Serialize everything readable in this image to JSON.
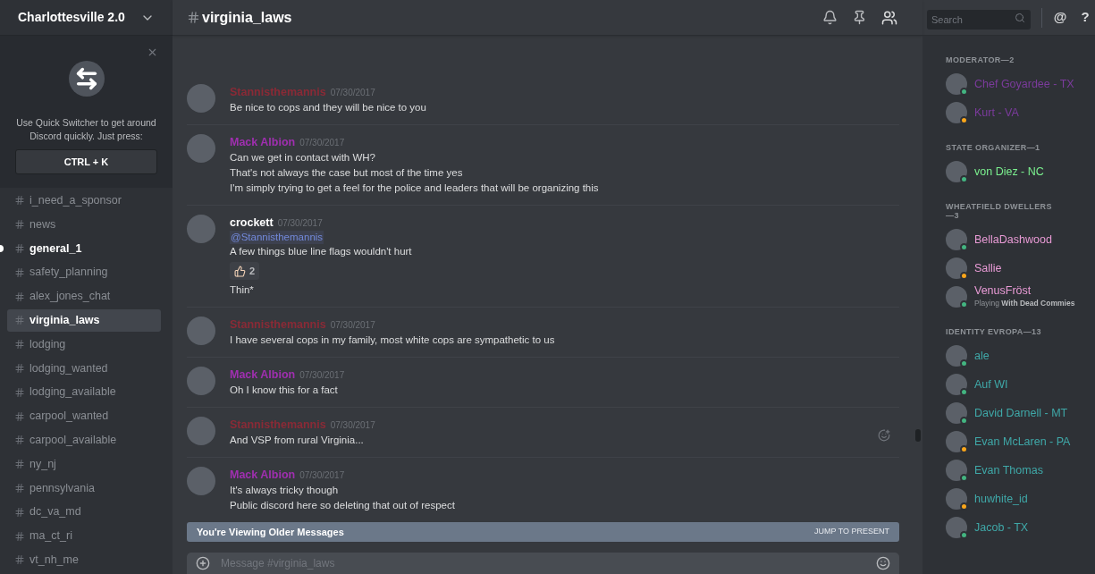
{
  "server": {
    "name": "Charlottesville 2.0"
  },
  "quick_switcher": {
    "text": "Use Quick Switcher to get around Discord quickly. Just press:",
    "shortcut": "CTRL + K"
  },
  "channels": [
    {
      "name": "i_need_a_sponsor",
      "selected": false,
      "unread": false
    },
    {
      "name": "news",
      "selected": false,
      "unread": false
    },
    {
      "name": "general_1",
      "selected": false,
      "unread": true
    },
    {
      "name": "safety_planning",
      "selected": false,
      "unread": false
    },
    {
      "name": "alex_jones_chat",
      "selected": false,
      "unread": false
    },
    {
      "name": "virginia_laws",
      "selected": true,
      "unread": false
    },
    {
      "name": "lodging",
      "selected": false,
      "unread": false
    },
    {
      "name": "lodging_wanted",
      "selected": false,
      "unread": false
    },
    {
      "name": "lodging_available",
      "selected": false,
      "unread": false
    },
    {
      "name": "carpool_wanted",
      "selected": false,
      "unread": false
    },
    {
      "name": "carpool_available",
      "selected": false,
      "unread": false
    },
    {
      "name": "ny_nj",
      "selected": false,
      "unread": false
    },
    {
      "name": "pennsylvania",
      "selected": false,
      "unread": false
    },
    {
      "name": "dc_va_md",
      "selected": false,
      "unread": false
    },
    {
      "name": "ma_ct_ri",
      "selected": false,
      "unread": false
    },
    {
      "name": "vt_nh_me",
      "selected": false,
      "unread": false
    }
  ],
  "header": {
    "channel": "virginia_laws",
    "search_placeholder": "Search",
    "extra_buttons": [
      "@",
      "?"
    ]
  },
  "messages": [
    {
      "author": "Stannisthemannis",
      "color": "#8a2a36",
      "time": "07/30/2017",
      "content": [
        {
          "kind": "text",
          "text": "Be nice to cops and they will be nice to you"
        }
      ]
    },
    {
      "author": "Mack Albion",
      "color": "#a02fb0",
      "time": "07/30/2017",
      "content": [
        {
          "kind": "text",
          "text": "Can we get in contact with WH?"
        },
        {
          "kind": "text",
          "text": "That's not always the case but most of the time yes"
        },
        {
          "kind": "text",
          "text": "I'm simply trying to get a feel for the police and leaders that will be organizing this"
        }
      ]
    },
    {
      "author": "crockett",
      "color": "#ffffff",
      "time": "07/30/2017",
      "content": [
        {
          "kind": "mention",
          "text": "@Stannisthemannis"
        },
        {
          "kind": "text",
          "text": "A few things blue line flags wouldn't hurt"
        },
        {
          "kind": "reaction",
          "text": "2"
        },
        {
          "kind": "text",
          "text": "Thin*"
        }
      ]
    },
    {
      "author": "Stannisthemannis",
      "color": "#8a2a36",
      "time": "07/30/2017",
      "content": [
        {
          "kind": "text",
          "text": "I have several cops in my family, most white cops are sympathetic to us"
        }
      ]
    },
    {
      "author": "Mack Albion",
      "color": "#a02fb0",
      "time": "07/30/2017",
      "content": [
        {
          "kind": "text",
          "text": "Oh I know this for a fact"
        }
      ]
    },
    {
      "author": "Stannisthemannis",
      "color": "#8a2a36",
      "time": "07/30/2017",
      "hovered": true,
      "content": [
        {
          "kind": "text",
          "text": "And VSP from rural Virginia..."
        }
      ]
    },
    {
      "author": "Mack Albion",
      "color": "#a02fb0",
      "time": "07/30/2017",
      "content": [
        {
          "kind": "text",
          "text": "It's always tricky though"
        },
        {
          "kind": "text",
          "text": "Public discord here so deleting that out of respect"
        }
      ]
    }
  ],
  "older_banner": {
    "text": "You're Viewing Older Messages",
    "action": "JUMP TO PRESENT"
  },
  "composer": {
    "placeholder": "Message #virginia_laws"
  },
  "member_groups": [
    {
      "title": "MODERATOR—2",
      "members": [
        {
          "name": "Chef Goyardee - TX",
          "color": "#7b3b9c",
          "idle": false
        },
        {
          "name": "Kurt - VA",
          "color": "#7b3b9c",
          "idle": true
        }
      ]
    },
    {
      "title": "STATE ORGANIZER—1",
      "members": [
        {
          "name": "von Diez - NC",
          "color": "#7bf08f",
          "idle": false
        }
      ]
    },
    {
      "title": "WHEATFIELD DWELLERS—3",
      "members": [
        {
          "name": "BellaDashwood",
          "color": "#e99bd6",
          "idle": false
        },
        {
          "name": "Sallie",
          "color": "#e99bd6",
          "idle": true
        },
        {
          "name": "VenusFröst",
          "color": "#e99bd6",
          "idle": false,
          "activity": "Playing **With Dead Commies**"
        }
      ]
    },
    {
      "title": "IDENTITY EVROPA—13",
      "members": [
        {
          "name": "ale",
          "color": "#3fa8a8",
          "idle": false
        },
        {
          "name": "Auf WI",
          "color": "#3fa8a8",
          "idle": false
        },
        {
          "name": "David Darnell - MT",
          "color": "#3fa8a8",
          "idle": false
        },
        {
          "name": "Evan McLaren - PA",
          "color": "#3fa8a8",
          "idle": true
        },
        {
          "name": "Evan Thomas",
          "color": "#3fa8a8",
          "idle": false
        },
        {
          "name": "huwhite_id",
          "color": "#3fa8a8",
          "idle": true
        },
        {
          "name": "Jacob - TX",
          "color": "#3fa8a8",
          "idle": false
        }
      ]
    }
  ]
}
